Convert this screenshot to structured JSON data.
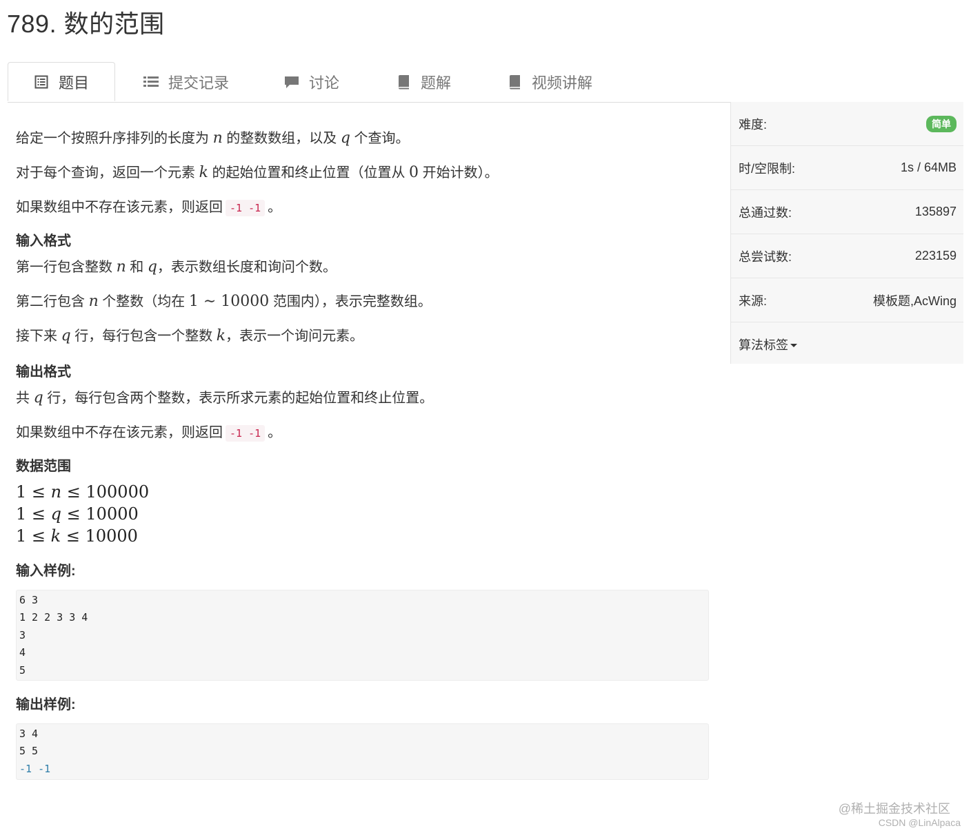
{
  "problem": {
    "title": "789. 数的范围"
  },
  "tabs": [
    {
      "label": "题目",
      "icon": "list-alt-icon"
    },
    {
      "label": "提交记录",
      "icon": "list-icon"
    },
    {
      "label": "讨论",
      "icon": "comment-icon"
    },
    {
      "label": "题解",
      "icon": "book-icon"
    },
    {
      "label": "视频讲解",
      "icon": "book-icon"
    }
  ],
  "content": {
    "desc1": {
      "a": "给定一个按照升序排列的长度为",
      "n": "n",
      "b": "的整数数组，以及",
      "q": "q",
      "c": "个查询。"
    },
    "desc2": {
      "a": "对于每个查询，返回一个元素",
      "k": "k",
      "b": "的起始位置和终止位置（位置从",
      "zero": "0",
      "c": "开始计数）。"
    },
    "desc3": {
      "a": "如果数组中不存在该元素，则返回",
      "code": "-1 -1",
      "b": "。"
    },
    "input_heading": "输入格式",
    "in1": {
      "a": "第一行包含整数",
      "n": "n",
      "b": "和",
      "q": "q",
      "c": "，表示数组长度和询问个数。"
    },
    "in2": {
      "a": "第二行包含",
      "n": "n",
      "b": "个整数（均在",
      "range": "1 ∼ 10000",
      "c": "范围内），表示完整数组。"
    },
    "in3": {
      "a": "接下来",
      "q": "q",
      "b": "行，每行包含一个整数",
      "k": "k",
      "c": "，表示一个询问元素。"
    },
    "output_heading": "输出格式",
    "out1": {
      "a": "共",
      "q": "q",
      "b": "行，每行包含两个整数，表示所求元素的起始位置和终止位置。"
    },
    "out2": {
      "a": "如果数组中不存在该元素，则返回",
      "code": "-1 -1",
      "b": "。"
    },
    "range_heading": "数据范围",
    "ranges": [
      {
        "lo": "1",
        "var": "n",
        "hi": "100000"
      },
      {
        "lo": "1",
        "var": "q",
        "hi": "10000"
      },
      {
        "lo": "1",
        "var": "k",
        "hi": "10000"
      }
    ],
    "sample_input_heading": "输入样例:",
    "sample_input_lines": [
      "6 3",
      "1 2 2 3 3 4",
      "3",
      "4",
      "5"
    ],
    "sample_output_heading": "输出样例:",
    "sample_output_lines": [
      "3 4",
      "5 5",
      "-1 -1"
    ]
  },
  "sidebar": {
    "difficulty_label": "难度:",
    "difficulty_value": "简单",
    "limit_label": "时/空限制:",
    "limit_value": "1s / 64MB",
    "pass_label": "总通过数:",
    "pass_value": "135897",
    "try_label": "总尝试数:",
    "try_value": "223159",
    "source_label": "来源:",
    "source_value": "模板题,AcWing",
    "tags_label": "算法标签"
  },
  "watermarks": {
    "juejin": "@稀土掘金技术社区",
    "csdn": "CSDN @LinAlpaca"
  },
  "colors": {
    "badge": "#5cb85c",
    "code_inline": "#c7254e",
    "negative_number": "#2f7ea8"
  }
}
